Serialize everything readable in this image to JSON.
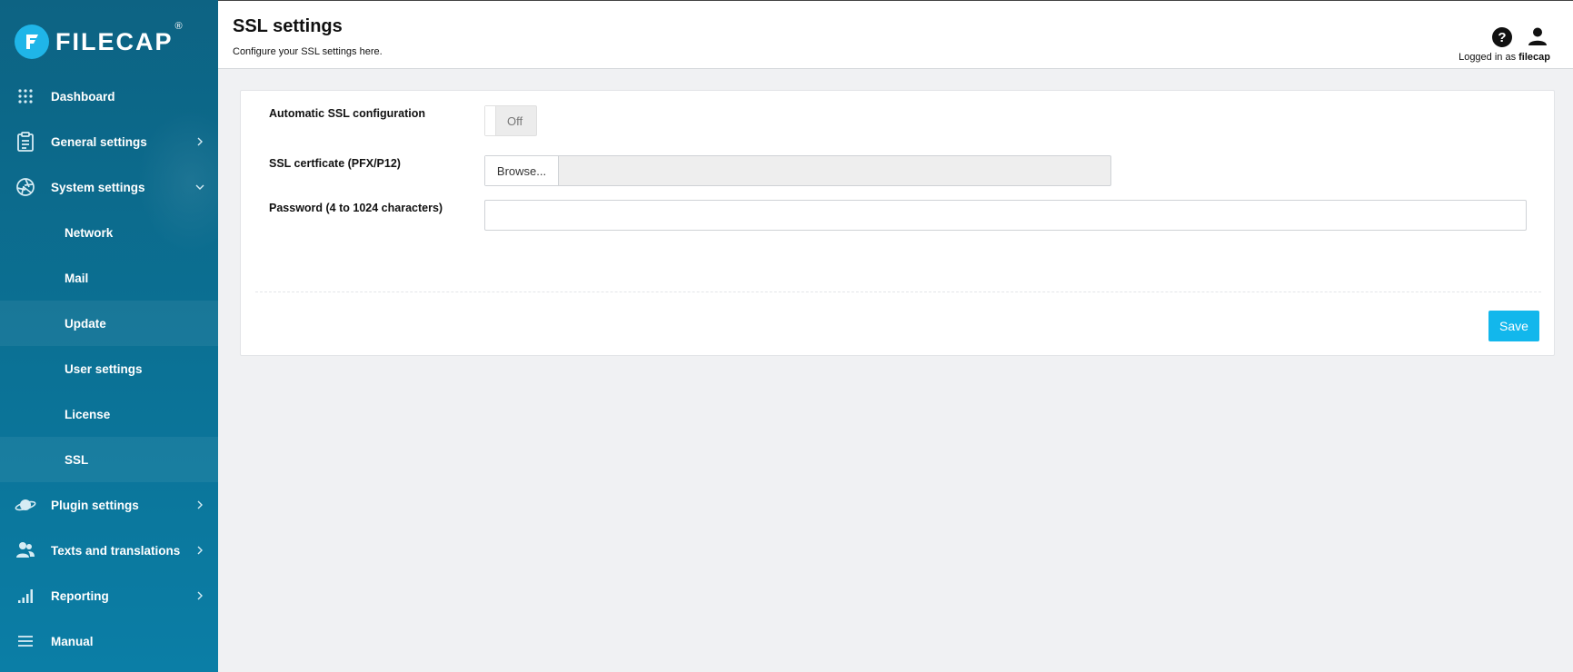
{
  "brand": {
    "name": "FILECAP",
    "reg_mark": "®"
  },
  "sidebar": {
    "items": [
      {
        "label": "Dashboard",
        "icon": "dashboard-grid-icon"
      },
      {
        "label": "General settings",
        "icon": "clipboard-icon",
        "expandable": true
      },
      {
        "label": "System settings",
        "icon": "aperture-icon",
        "expanded": true
      },
      {
        "label": "Plugin settings",
        "icon": "planet-icon",
        "expandable": true
      },
      {
        "label": "Texts and translations",
        "icon": "users-icon",
        "expandable": true
      },
      {
        "label": "Reporting",
        "icon": "signal-bars-icon",
        "expandable": true
      },
      {
        "label": "Manual",
        "icon": "menu-lines-icon"
      }
    ],
    "system_subitems": [
      {
        "label": "Network"
      },
      {
        "label": "Mail"
      },
      {
        "label": "Update"
      },
      {
        "label": "User settings"
      },
      {
        "label": "License"
      },
      {
        "label": "SSL",
        "active": true
      }
    ]
  },
  "header": {
    "title": "SSL settings",
    "subtitle": "Configure your SSL settings here.",
    "help_glyph": "?",
    "logged_in_prefix": "Logged in as",
    "username": "filecap"
  },
  "form": {
    "auto_ssl_label": "Automatic SSL configuration",
    "auto_ssl_state": "Off",
    "cert_label": "SSL certficate (PFX/P12)",
    "browse_label": "Browse...",
    "password_label": "Password (4 to 1024 characters)",
    "password_value": "",
    "save_label": "Save"
  },
  "colors": {
    "sidebar_top": "#0d6383",
    "sidebar_bottom": "#0b7ea6",
    "accent": "#12b7ec",
    "logo": "#1fb5e8"
  }
}
